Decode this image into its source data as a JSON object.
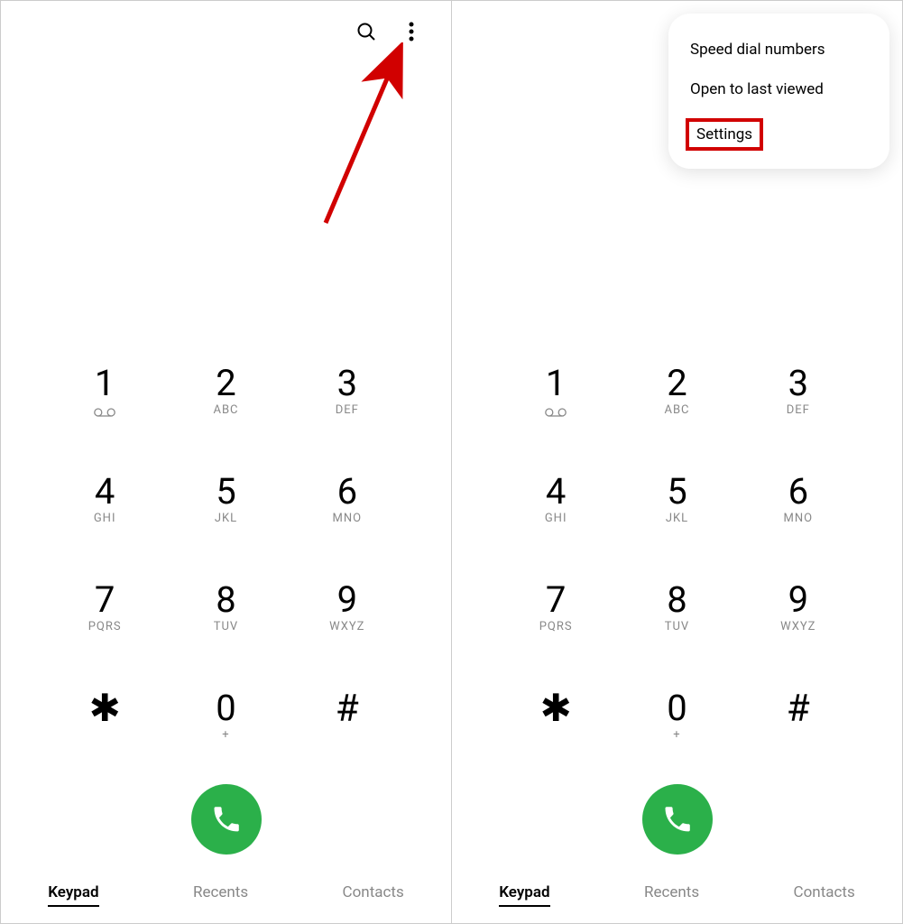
{
  "keypad": {
    "keys": [
      {
        "digit": "1",
        "sub": ""
      },
      {
        "digit": "2",
        "sub": "ABC"
      },
      {
        "digit": "3",
        "sub": "DEF"
      },
      {
        "digit": "4",
        "sub": "GHI"
      },
      {
        "digit": "5",
        "sub": "JKL"
      },
      {
        "digit": "6",
        "sub": "MNO"
      },
      {
        "digit": "7",
        "sub": "PQRS"
      },
      {
        "digit": "8",
        "sub": "TUV"
      },
      {
        "digit": "9",
        "sub": "WXYZ"
      },
      {
        "digit": "✱",
        "sub": ""
      },
      {
        "digit": "0",
        "sub": "+"
      },
      {
        "digit": "#",
        "sub": ""
      }
    ]
  },
  "tabs": {
    "keypad": "Keypad",
    "recents": "Recents",
    "contacts": "Contacts"
  },
  "menu": {
    "speed_dial": "Speed dial numbers",
    "open_last": "Open to last viewed",
    "settings": "Settings"
  },
  "colors": {
    "call_green": "#2bb04a",
    "annotate_red": "#d10000"
  }
}
